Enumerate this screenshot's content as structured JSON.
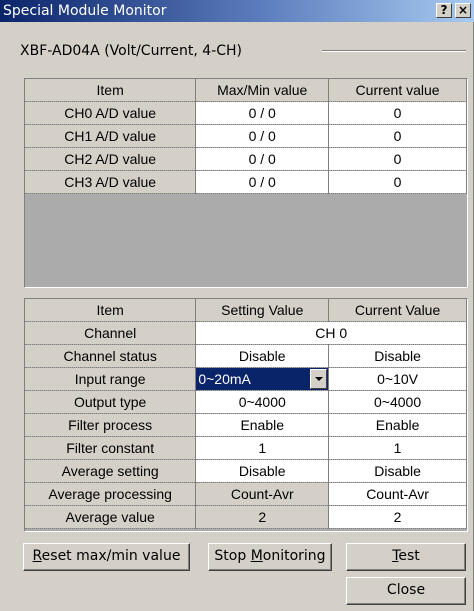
{
  "window": {
    "title": "Special Module Monitor",
    "help_label": "?",
    "close_label": "×"
  },
  "module_label": "XBF-AD04A (Volt/Current, 4-CH)",
  "monitor_table": {
    "headers": [
      "Item",
      "Max/Min value",
      "Current value"
    ],
    "rows": [
      {
        "item": "CH0 A/D value",
        "maxmin": "0 / 0",
        "current": "0"
      },
      {
        "item": "CH1 A/D value",
        "maxmin": "0 / 0",
        "current": "0"
      },
      {
        "item": "CH2 A/D value",
        "maxmin": "0 / 0",
        "current": "0"
      },
      {
        "item": "CH3 A/D value",
        "maxmin": "0 / 0",
        "current": "0"
      }
    ]
  },
  "setting_table": {
    "headers": [
      "Item",
      "Setting Value",
      "Current Value"
    ],
    "channel": {
      "item": "Channel",
      "value": "CH 0"
    },
    "rows": [
      {
        "item": "Channel status",
        "setting": "Disable",
        "current": "Disable"
      },
      {
        "item": "Input range",
        "setting": "0~20mA",
        "current": "0~10V"
      },
      {
        "item": "Output type",
        "setting": "0~4000",
        "current": "0~4000"
      },
      {
        "item": "Filter process",
        "setting": "Enable",
        "current": "Enable"
      },
      {
        "item": "Filter constant",
        "setting": "1",
        "current": "1"
      },
      {
        "item": "Average setting",
        "setting": "Disable",
        "current": "Disable"
      },
      {
        "item": "Average processing",
        "setting": "Count-Avr",
        "current": "Count-Avr"
      },
      {
        "item": "Average value",
        "setting": "2",
        "current": "2"
      }
    ]
  },
  "buttons": {
    "reset": {
      "pre": "",
      "mnemonic": "R",
      "post": "eset max/min value"
    },
    "stop": {
      "pre": "Stop ",
      "mnemonic": "M",
      "post": "onitoring"
    },
    "test": {
      "pre": "",
      "mnemonic": "T",
      "post": "est"
    },
    "close": "Close"
  }
}
